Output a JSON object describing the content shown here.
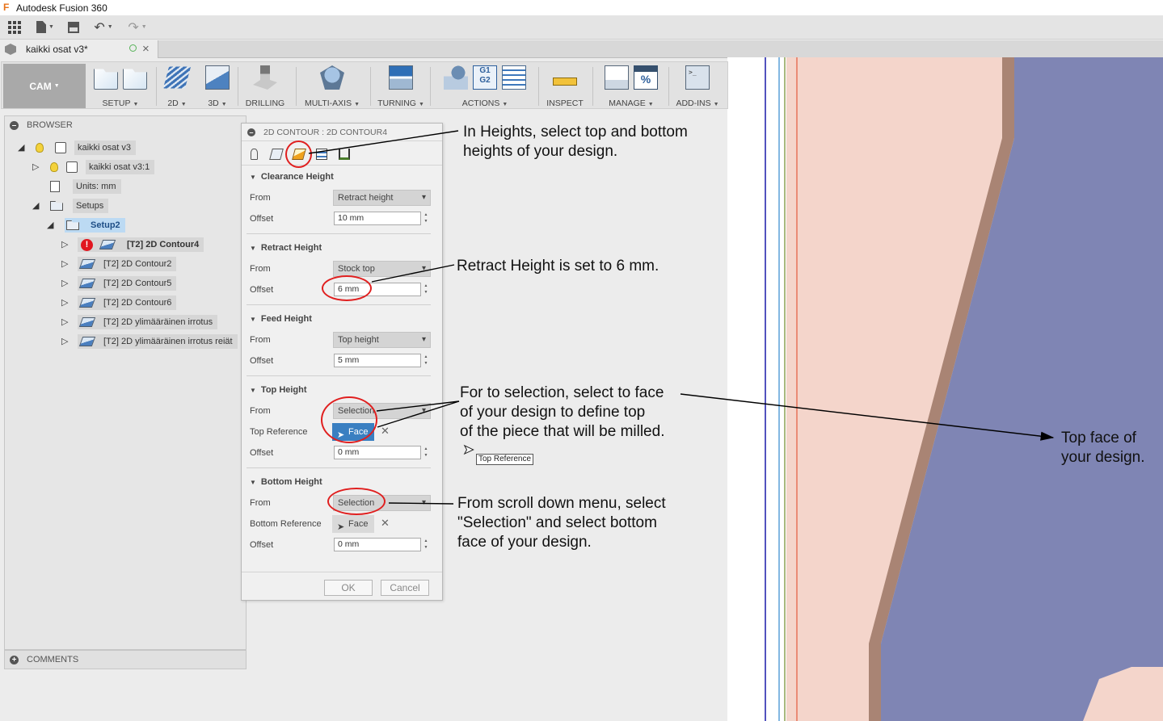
{
  "app": {
    "title": "Autodesk Fusion 360"
  },
  "document_tab": {
    "name": "kaikki osat v3*"
  },
  "toolbar": {
    "workspace": "CAM",
    "groups": [
      {
        "label": "SETUP"
      },
      {
        "label": "2D"
      },
      {
        "label": "3D"
      },
      {
        "label": "DRILLING"
      },
      {
        "label": "MULTI-AXIS"
      },
      {
        "label": "TURNING"
      },
      {
        "label": "ACTIONS"
      },
      {
        "label": "INSPECT"
      },
      {
        "label": "MANAGE"
      },
      {
        "label": "ADD-INS"
      }
    ],
    "g1g2_text": "G1\nG2",
    "pct_text": "%",
    "term_text": ">_"
  },
  "browser": {
    "header": "BROWSER",
    "items": [
      {
        "label": "kaikki osat v3"
      },
      {
        "label": "kaikki osat v3:1"
      },
      {
        "label": "Units: mm"
      },
      {
        "label": "Setups"
      },
      {
        "label": "Setup2"
      },
      {
        "label": "[T2] 2D Contour4",
        "warning": "!"
      },
      {
        "label": "[T2] 2D Contour2"
      },
      {
        "label": "[T2] 2D Contour5"
      },
      {
        "label": "[T2] 2D Contour6"
      },
      {
        "label": "[T2] 2D ylimääräinen irrotus"
      },
      {
        "label": "[T2] 2D ylimääräinen irrotus reiät"
      }
    ],
    "comments": "COMMENTS"
  },
  "dialog": {
    "title": "2D CONTOUR : 2D CONTOUR4",
    "from_label": "From",
    "offset_label": "Offset",
    "sections": {
      "clearance": {
        "title": "Clearance Height",
        "from": "Retract height",
        "offset": "10 mm"
      },
      "retract": {
        "title": "Retract Height",
        "from": "Stock top",
        "offset": "6 mm"
      },
      "feed": {
        "title": "Feed Height",
        "from": "Top height",
        "offset": "5 mm"
      },
      "top": {
        "title": "Top Height",
        "from": "Selection",
        "ref_label": "Top Reference",
        "ref_value": "Face",
        "offset": "0 mm"
      },
      "bottom": {
        "title": "Bottom Height",
        "from": "Selection",
        "ref_label": "Bottom Reference",
        "ref_value": "Face",
        "offset": "0 mm"
      }
    },
    "ok": "OK",
    "cancel": "Cancel"
  },
  "annotations": {
    "heights": "In Heights, select top and bottom\nheights of your design.",
    "retract": "Retract Height is set to 6 mm.",
    "top_selection": "For to selection, select to face\nof your design to define top\nof the piece that will be milled.",
    "bottom_selection": "From scroll down menu, select\n\"Selection\" and select bottom\nface of your design.",
    "top_face": "Top face of\nyour design.",
    "tooltip": "Top Reference"
  },
  "colors": {
    "model_face": "#7f85b4",
    "model_background": "#f4d5cb",
    "model_edge": "#a98474",
    "annotation_ring": "#e01f1f",
    "selected_face_button": "#3a7fc1"
  }
}
